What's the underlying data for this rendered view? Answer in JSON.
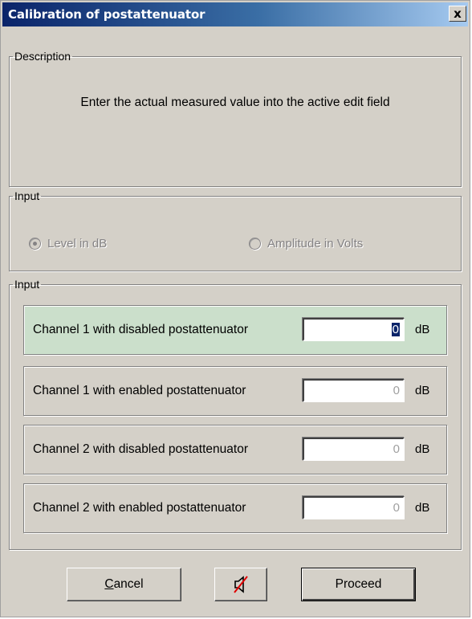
{
  "window": {
    "title": "Calibration of postattenuator",
    "close_glyph": "x"
  },
  "description_group": {
    "legend": "Description",
    "text": "Enter the actual measured value into the active edit field"
  },
  "input_mode_group": {
    "legend": "Input",
    "options": [
      {
        "label": "Level in dB",
        "selected": true,
        "enabled": false
      },
      {
        "label": "Amplitude in Volts",
        "selected": false,
        "enabled": false
      }
    ]
  },
  "channels_group": {
    "legend": "Input",
    "active_row_color": "#cbdfcb",
    "rows": [
      {
        "label": "Channel 1 with disabled postattenuator",
        "value": "0",
        "unit": "dB",
        "active": true
      },
      {
        "label": "Channel 1 with enabled postattenuator",
        "value": "0",
        "unit": "dB",
        "active": false
      },
      {
        "label": "Channel 2 with disabled postattenuator",
        "value": "0",
        "unit": "dB",
        "active": false
      },
      {
        "label": "Channel 2 with enabled postattenuator",
        "value": "0",
        "unit": "dB",
        "active": false
      }
    ]
  },
  "buttons": {
    "cancel_mnemonic": "C",
    "cancel_rest": "ancel",
    "mute_icon": "speaker-muted-icon",
    "proceed": "Proceed"
  }
}
